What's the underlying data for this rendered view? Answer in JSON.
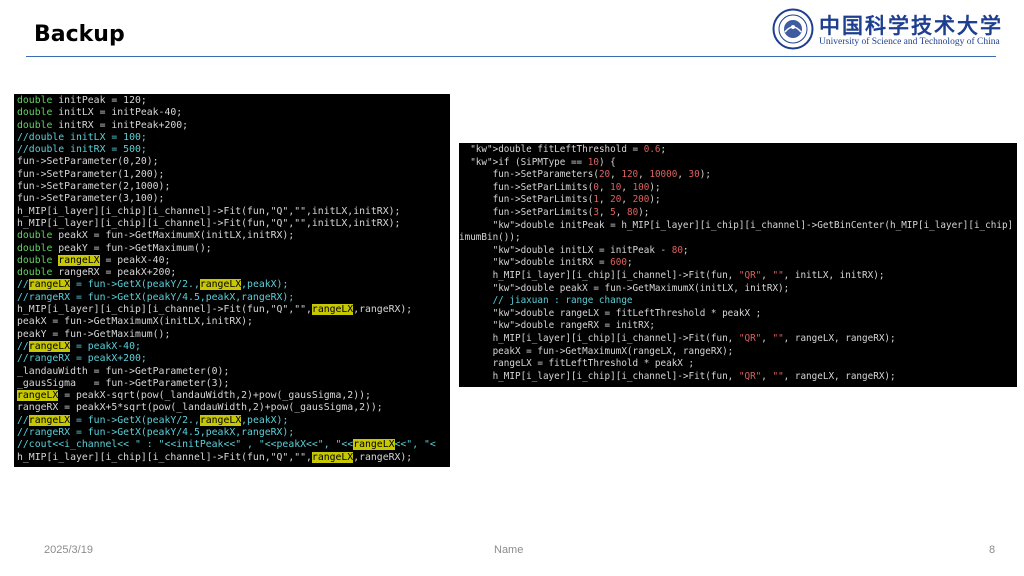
{
  "slide": {
    "title": "Backup",
    "logo": {
      "name_cn": "中国科学技术大学",
      "name_en": "University of Science and Technology of China"
    },
    "footer": {
      "date": "2025/3/19",
      "center": "Name",
      "page": "8"
    }
  },
  "code_left": [
    "double initPeak = 120;",
    "double initLX = initPeak-40;",
    "double initRX = initPeak+200;",
    "//double initLX = 100;",
    "//double initRX = 500;",
    "fun->SetParameter(0,20);",
    "fun->SetParameter(1,200);",
    "fun->SetParameter(2,1000);",
    "fun->SetParameter(3,100);",
    "h_MIP[i_layer][i_chip][i_channel]->Fit(fun,\"Q\",\"\",initLX,initRX);",
    "h_MIP[i_layer][i_chip][i_channel]->Fit(fun,\"Q\",\"\",initLX,initRX);",
    "double peakX = fun->GetMaximumX(initLX,initRX);",
    "double peakY = fun->GetMaximum();",
    "double rangeLX = peakX-40;",
    "double rangeRX = peakX+200;",
    "//rangeLX = fun->GetX(peakY/2.,rangeLX,peakX);",
    "//rangeRX = fun->GetX(peakY/4.5,peakX,rangeRX);",
    "h_MIP[i_layer][i_chip][i_channel]->Fit(fun,\"Q\",\"\",rangeLX,rangeRX);",
    "peakX = fun->GetMaximumX(initLX,initRX);",
    "peakY = fun->GetMaximum();",
    "//rangeLX = peakX-40;",
    "//rangeRX = peakX+200;",
    "_landauWidth = fun->GetParameter(0);",
    "_gausSigma   = fun->GetParameter(3);",
    "rangeLX = peakX-sqrt(pow(_landauWidth,2)+pow(_gausSigma,2));",
    "rangeRX = peakX+5*sqrt(pow(_landauWidth,2)+pow(_gausSigma,2));",
    "//rangeLX = fun->GetX(peakY/2.,rangeLX,peakX);",
    "//rangeRX = fun->GetX(peakY/4.5,peakX,rangeRX);",
    "//cout<<i_channel<< \" : \"<<initPeak<<\" , \"<<peakX<<\", \"<<rangeLX<<\", \"<",
    "h_MIP[i_layer][i_chip][i_channel]->Fit(fun,\"Q\",\"\",rangeLX,rangeRX);"
  ],
  "code_right": [
    "  double fitLeftThreshold = 0.6;",
    "  if (SiPMType == 10) {",
    "      fun->SetParameters(20, 120, 10000, 30);",
    "      fun->SetParLimits(0, 10, 100);",
    "      fun->SetParLimits(1, 20, 200);",
    "      fun->SetParLimits(3, 5, 80);",
    "      double initPeak = h_MIP[i_layer][i_chip][i_channel]->GetBinCenter(h_MIP[i_layer][i_chip]",
    "imumBin());",
    "      double initLX = initPeak - 80;",
    "      double initRX = 600;",
    "      h_MIP[i_layer][i_chip][i_channel]->Fit(fun, \"QR\", \"\", initLX, initRX);",
    "      double peakX = fun->GetMaximumX(initLX, initRX);",
    "      // jiaxuan : range change",
    "      double rangeLX = fitLeftThreshold * peakX ;",
    "      double rangeRX = initRX;",
    "      h_MIP[i_layer][i_chip][i_channel]->Fit(fun, \"QR\", \"\", rangeLX, rangeRX);",
    "      peakX = fun->GetMaximumX(rangeLX, rangeRX);",
    "      rangeLX = fitLeftThreshold * peakX ;",
    "      h_MIP[i_layer][i_chip][i_channel]->Fit(fun, \"QR\", \"\", rangeLX, rangeRX);"
  ]
}
